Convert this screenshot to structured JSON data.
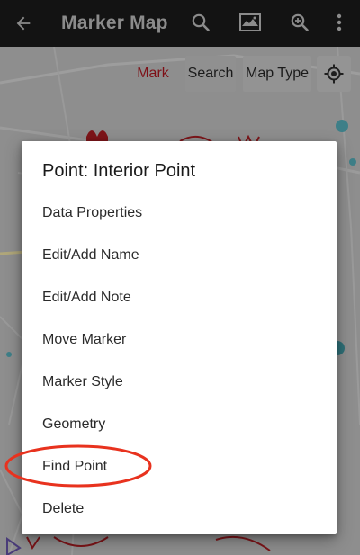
{
  "appbar": {
    "title": "Marker Map"
  },
  "map_toolbar": {
    "mark_label": "Mark",
    "search_label": "Search",
    "maptype_label": "Map Type"
  },
  "dialog": {
    "title": "Point: Interior Point",
    "items": [
      "Data Properties",
      "Edit/Add Name",
      "Edit/Add Note",
      "Move Marker",
      "Marker Style",
      "Geometry",
      "Find Point",
      "Delete"
    ]
  },
  "colors": {
    "appbar_bg": "#131313",
    "dialog_bg": "#ffffff",
    "annotation": "#e8321e",
    "mark_text": "#7e0f16"
  },
  "icons": {
    "back": "arrow-left-icon",
    "search": "search-icon",
    "map": "map-image-icon",
    "zoom": "zoom-in-icon",
    "overflow": "more-vert-icon",
    "locate": "gps-locate-icon"
  }
}
